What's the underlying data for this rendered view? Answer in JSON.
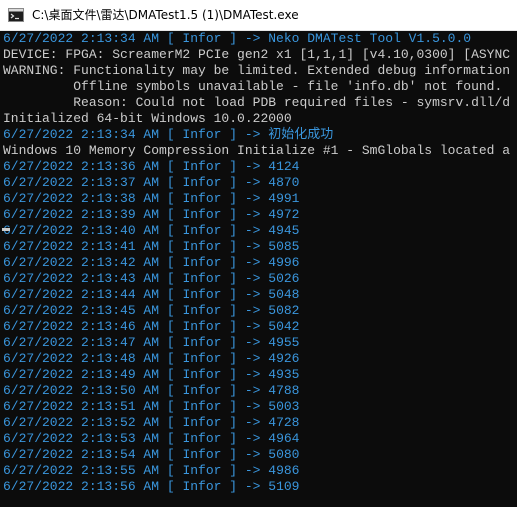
{
  "window": {
    "title": "C:\\桌面文件\\雷达\\DMATest1.5 (1)\\DMATest.exe",
    "icon": "console-app-icon"
  },
  "console": {
    "header_lines": [
      {
        "text": "6/27/2022 2:13:34 AM [ Infor ] -> Neko DMATest Tool V1.5.0.0",
        "color": "#3a96dd"
      },
      {
        "text": "DEVICE: FPGA: ScreamerM2 PCIe gen2 x1 [1,1,1] [v4.10,0300] [ASYNC",
        "color": "#cccccc"
      },
      {
        "text": "WARNING: Functionality may be limited. Extended debug information",
        "color": "#cccccc"
      },
      {
        "text": "         Offline symbols unavailable - file 'info.db' not found.",
        "color": "#cccccc"
      },
      {
        "text": "         Reason: Could not load PDB required files - symsrv.dll/d",
        "color": "#cccccc"
      },
      {
        "text": "Initialized 64-bit Windows 10.0.22000",
        "color": "#cccccc"
      },
      {
        "text": "6/27/2022 2:13:34 AM [ Infor ] -> 初始化成功",
        "color": "#3a96dd"
      },
      {
        "text": "Windows 10 Memory Compression Initialize #1 - SmGlobals located a",
        "color": "#cccccc"
      }
    ],
    "log_entries": [
      {
        "time": "6/27/2022 2:13:36 AM",
        "level": "Infor",
        "value": "4124"
      },
      {
        "time": "6/27/2022 2:13:37 AM",
        "level": "Infor",
        "value": "4870"
      },
      {
        "time": "6/27/2022 2:13:38 AM",
        "level": "Infor",
        "value": "4991"
      },
      {
        "time": "6/27/2022 2:13:39 AM",
        "level": "Infor",
        "value": "4972"
      },
      {
        "time": "6/27/2022 2:13:40 AM",
        "level": "Infor",
        "value": "4945"
      },
      {
        "time": "6/27/2022 2:13:41 AM",
        "level": "Infor",
        "value": "5085"
      },
      {
        "time": "6/27/2022 2:13:42 AM",
        "level": "Infor",
        "value": "4996"
      },
      {
        "time": "6/27/2022 2:13:43 AM",
        "level": "Infor",
        "value": "5026"
      },
      {
        "time": "6/27/2022 2:13:44 AM",
        "level": "Infor",
        "value": "5048"
      },
      {
        "time": "6/27/2022 2:13:45 AM",
        "level": "Infor",
        "value": "5082"
      },
      {
        "time": "6/27/2022 2:13:46 AM",
        "level": "Infor",
        "value": "5042"
      },
      {
        "time": "6/27/2022 2:13:47 AM",
        "level": "Infor",
        "value": "4955"
      },
      {
        "time": "6/27/2022 2:13:48 AM",
        "level": "Infor",
        "value": "4926"
      },
      {
        "time": "6/27/2022 2:13:49 AM",
        "level": "Infor",
        "value": "4935"
      },
      {
        "time": "6/27/2022 2:13:50 AM",
        "level": "Infor",
        "value": "4788"
      },
      {
        "time": "6/27/2022 2:13:51 AM",
        "level": "Infor",
        "value": "5003"
      },
      {
        "time": "6/27/2022 2:13:52 AM",
        "level": "Infor",
        "value": "4728"
      },
      {
        "time": "6/27/2022 2:13:53 AM",
        "level": "Infor",
        "value": "4964"
      },
      {
        "time": "6/27/2022 2:13:54 AM",
        "level": "Infor",
        "value": "5080"
      },
      {
        "time": "6/27/2022 2:13:55 AM",
        "level": "Infor",
        "value": "4986"
      },
      {
        "time": "6/27/2022 2:13:56 AM",
        "level": "Infor",
        "value": "5109"
      }
    ]
  },
  "colors": {
    "background": "#0c0c0c",
    "text": "#cccccc",
    "info": "#3a96dd"
  }
}
